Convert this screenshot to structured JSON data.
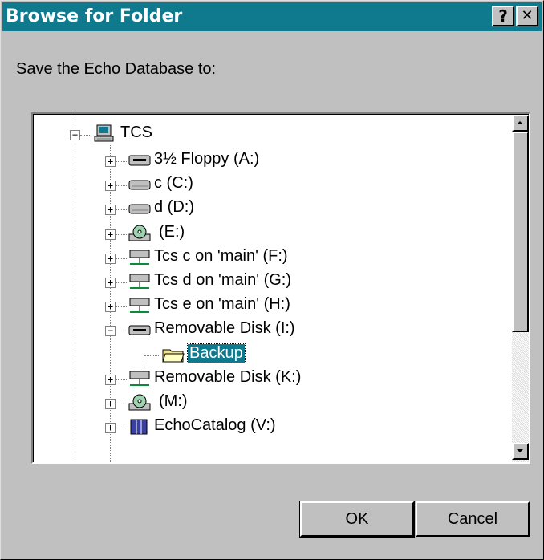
{
  "window": {
    "title": "Browse for Folder",
    "help_label": "?",
    "close_label": "✕"
  },
  "prompt": "Save the Echo Database to:",
  "tree": {
    "root": {
      "label": "TCS",
      "icon": "computer-icon"
    },
    "items": [
      {
        "label": "3½ Floppy (A:)",
        "icon": "floppy-drive-icon"
      },
      {
        "label": "c (C:)",
        "icon": "hard-drive-icon"
      },
      {
        "label": "d (D:)",
        "icon": "hard-drive-icon"
      },
      {
        "label": "(E:)",
        "icon": "cd-drive-icon"
      },
      {
        "label": "Tcs c on 'main' (F:)",
        "icon": "network-drive-icon"
      },
      {
        "label": "Tcs d on 'main' (G:)",
        "icon": "network-drive-icon"
      },
      {
        "label": "Tcs e on 'main' (H:)",
        "icon": "network-drive-icon"
      },
      {
        "label": "Removable Disk (I:)",
        "icon": "removable-drive-icon"
      },
      {
        "label": "Backup",
        "icon": "open-folder-icon",
        "selected": true
      },
      {
        "label": "Removable Disk (K:)",
        "icon": "network-drive-icon"
      },
      {
        "label": "(M:)",
        "icon": "cd-drive-icon"
      },
      {
        "label": "EchoCatalog (V:)",
        "icon": "book-drive-icon"
      }
    ]
  },
  "buttons": {
    "ok": "OK",
    "cancel": "Cancel"
  },
  "colors": {
    "titlebar": "#0f7a8d",
    "selection": "#0f7a8d",
    "face": "#c0c0c0"
  }
}
